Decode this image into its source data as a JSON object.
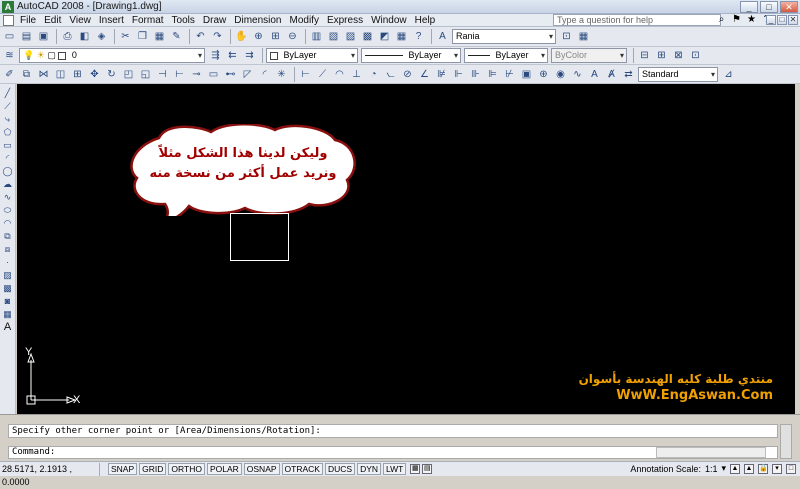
{
  "window": {
    "title": "AutoCAD 2008 - [Drawing1.dwg]",
    "app_icon_text": "A",
    "minimize": "_",
    "maximize": "□",
    "close": "✕"
  },
  "menubar": {
    "items": [
      "File",
      "Edit",
      "View",
      "Insert",
      "Format",
      "Tools",
      "Draw",
      "Dimension",
      "Modify",
      "Express",
      "Window",
      "Help"
    ],
    "help_placeholder": "Type a question for help"
  },
  "toolbar1": {
    "text_style_value": "Rania",
    "icons": [
      "new-icon",
      "open-icon",
      "save-icon",
      "print-icon",
      "preview-icon",
      "publish-icon",
      "cut-icon",
      "copy-icon",
      "paste-icon",
      "matchprop-icon",
      "undo-icon",
      "redo-icon",
      "pan-icon",
      "zoom-realtime-icon",
      "zoom-window-icon",
      "zoom-previous-icon",
      "properties-icon",
      "designcenter-icon",
      "toolpalettes-icon",
      "sheetset-icon",
      "markup-icon",
      "quickcalc-icon",
      "help-icon"
    ]
  },
  "toolbar2": {
    "layer_value": "0",
    "color_value": "ByLayer",
    "linetype_value": "ByLayer",
    "lineweight_value": "ByLayer",
    "plotstyle_value": "ByColor"
  },
  "toolbar3": {
    "dimstyle_value": "Standard"
  },
  "left_toolbar": {
    "icons": [
      "line-icon",
      "construction-line-icon",
      "polyline-icon",
      "polygon-icon",
      "rectangle-icon",
      "arc-icon",
      "circle-icon",
      "revcloud-icon",
      "spline-icon",
      "ellipse-icon",
      "ellipse-arc-icon",
      "insert-block-icon",
      "make-block-icon",
      "point-icon",
      "hatch-icon",
      "gradient-icon",
      "region-icon",
      "table-icon",
      "mtext-icon"
    ],
    "mtext_glyph": "A"
  },
  "canvas": {
    "bubble_line1": "وليكن لدينا هذا الشكل مثلاً",
    "bubble_line2": "ونريد عمل أكثر من نسخة منه",
    "ucs_y": "Y",
    "ucs_x": "X",
    "watermark_line1": "منتدي طلبة كليه الهندسة بأسوان",
    "watermark_line2": "WwW.EngAswan.Com",
    "bubble_fill": "#ffffff",
    "bubble_stroke": "#8a1010",
    "watermark_color": "#f0a000"
  },
  "command": {
    "history": "Specify other corner point or [Area/Dimensions/Rotation]:",
    "prompt": "Command:"
  },
  "status": {
    "coords": "28.5171, 2.1913 , 0.0000",
    "toggles": [
      "SNAP",
      "GRID",
      "ORTHO",
      "POLAR",
      "OSNAP",
      "OTRACK",
      "DUCS",
      "DYN",
      "LWT"
    ],
    "annotation_label": "Annotation Scale:",
    "annotation_value": "1:1"
  }
}
